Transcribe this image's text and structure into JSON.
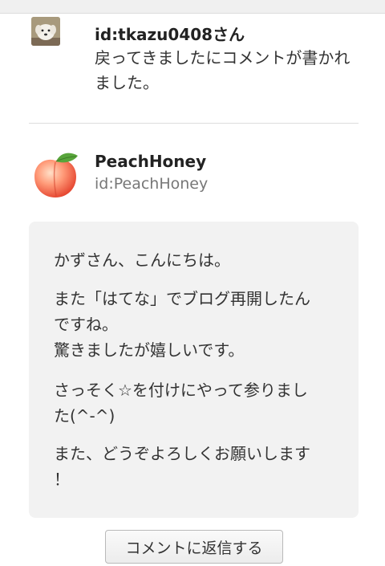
{
  "notification": {
    "user_label": "id:tkazu0408さん",
    "message": "戻ってきましたにコメントが書かれました。"
  },
  "commenter": {
    "display_name": "PeachHoney",
    "user_id": "id:PeachHoney",
    "avatar_icon": "peach-icon"
  },
  "comment": {
    "line1": "かずさん、こんにちは。",
    "line2": "また「はてな」でブログ再開したん",
    "line2b": "ですね。",
    "line2c": "驚きましたが嬉しいです。",
    "line3": "さっそく☆を付けにやって参りまし",
    "line3b": "た(^-^)",
    "line4": "また、どうぞよろしくお願いします",
    "line4b": "！"
  },
  "actions": {
    "reply_label": "コメントに返信する"
  },
  "colors": {
    "comment_background": "#f2f2f2",
    "divider": "#dddddd",
    "muted_text": "#777777"
  }
}
